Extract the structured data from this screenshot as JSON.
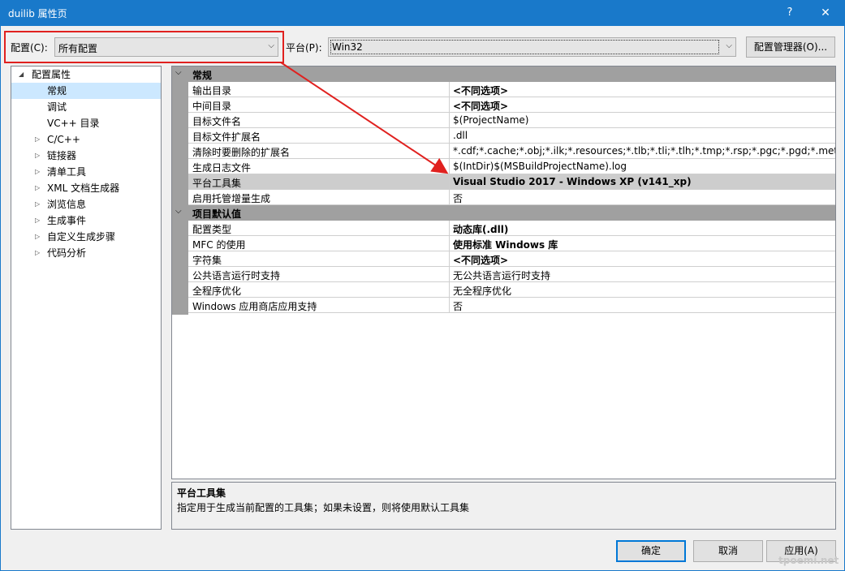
{
  "window": {
    "title": "duilib 属性页",
    "help_label": "?",
    "close_label": "✕"
  },
  "toolbar": {
    "config_label": "配置(C):",
    "config_value": "所有配置",
    "platform_label": "平台(P):",
    "platform_value": "Win32",
    "config_manager_label": "配置管理器(O)..."
  },
  "tree": {
    "root": "配置属性",
    "items": [
      {
        "label": "常规"
      },
      {
        "label": "调试"
      },
      {
        "label": "VC++ 目录"
      },
      {
        "label": "C/C++"
      },
      {
        "label": "链接器"
      },
      {
        "label": "清单工具"
      },
      {
        "label": "XML 文档生成器"
      },
      {
        "label": "浏览信息"
      },
      {
        "label": "生成事件"
      },
      {
        "label": "自定义生成步骤"
      },
      {
        "label": "代码分析"
      }
    ]
  },
  "grid": {
    "categories": [
      {
        "label": "常规",
        "rows": [
          {
            "name": "输出目录",
            "value": "<不同选项>"
          },
          {
            "name": "中间目录",
            "value": "<不同选项>"
          },
          {
            "name": "目标文件名",
            "value": "$(ProjectName)"
          },
          {
            "name": "目标文件扩展名",
            "value": ".dll"
          },
          {
            "name": "清除时要删除的扩展名",
            "value": "*.cdf;*.cache;*.obj;*.ilk;*.resources;*.tlb;*.tli;*.tlh;*.tmp;*.rsp;*.pgc;*.pgd;*.meta;*.tlog;"
          },
          {
            "name": "生成日志文件",
            "value": "$(IntDir)$(MSBuildProjectName).log"
          },
          {
            "name": "平台工具集",
            "value": "Visual Studio 2017 - Windows XP (v141_xp)"
          },
          {
            "name": "启用托管增量生成",
            "value": "否"
          }
        ]
      },
      {
        "label": "项目默认值",
        "rows": [
          {
            "name": "配置类型",
            "value": "动态库(.dll)"
          },
          {
            "name": "MFC 的使用",
            "value": "使用标准 Windows 库"
          },
          {
            "name": "字符集",
            "value": "<不同选项>"
          },
          {
            "name": "公共语言运行时支持",
            "value": "无公共语言运行时支持"
          },
          {
            "name": "全程序优化",
            "value": "无全程序优化"
          },
          {
            "name": "Windows 应用商店应用支持",
            "value": "否"
          }
        ]
      }
    ]
  },
  "description": {
    "title": "平台工具集",
    "text": "指定用于生成当前配置的工具集；如果未设置，则将使用默认工具集"
  },
  "buttons": {
    "ok": "确定",
    "cancel": "取消",
    "apply": "应用(A)"
  },
  "watermark": "tpoemi.net",
  "colors": {
    "titlebar": "#1979ca",
    "highlight": "#e0211f",
    "selection": "#cce8ff"
  }
}
